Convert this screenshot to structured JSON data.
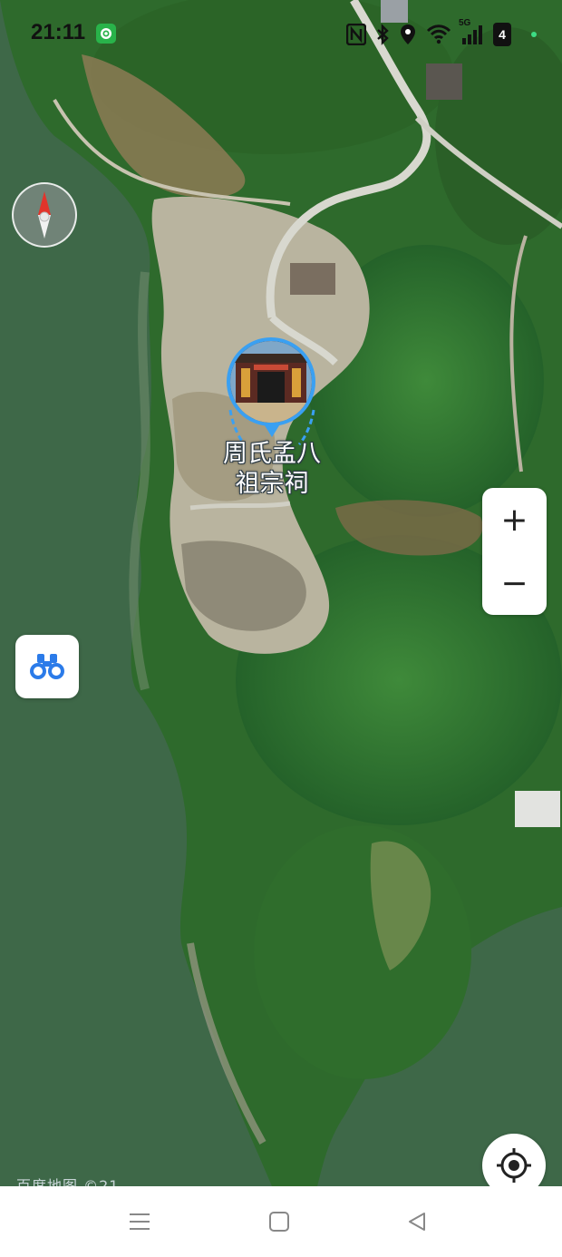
{
  "status_bar": {
    "time": "21:11",
    "network_label": "5G",
    "battery_level": "4",
    "icons": [
      "app-notification-icon",
      "nfc-icon",
      "bluetooth-icon",
      "location-icon",
      "wifi-icon",
      "signal-icon",
      "battery-icon"
    ]
  },
  "map": {
    "poi": {
      "name_line1": "周氏孟八",
      "name_line2": "祖宗祠",
      "marker_border_color": "#3aa0f2"
    },
    "watermark": "百度地图 ©21",
    "controls": {
      "zoom_in_label": "+",
      "zoom_out_label": "−"
    },
    "icons": [
      "compass-icon",
      "binoculars-icon",
      "locate-icon"
    ]
  },
  "nav_bar": {
    "icons": [
      "menu-icon",
      "home-icon",
      "back-icon"
    ]
  }
}
